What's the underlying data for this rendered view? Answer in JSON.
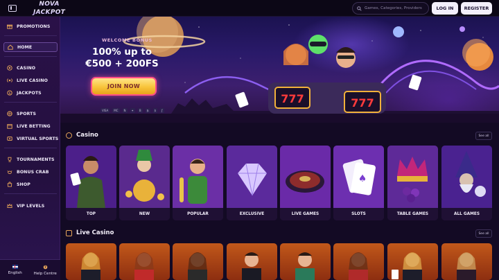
{
  "topbar": {
    "logo_line1": "NOVA",
    "logo_line2": "JACKPOT",
    "search_placeholder": "Games, Categories, Providers",
    "login_label": "LOG IN",
    "register_label": "REGISTER"
  },
  "sidebar": {
    "items": [
      {
        "label": "PROMOTIONS",
        "icon": "gift-icon"
      },
      {
        "label": "HOME",
        "icon": "home-icon",
        "active": true
      },
      {
        "label": "CASINO",
        "icon": "chip-icon"
      },
      {
        "label": "LIVE CASINO",
        "icon": "live-icon"
      },
      {
        "label": "JACKPOTS",
        "icon": "jackpot-icon"
      },
      {
        "label": "SPORTS",
        "icon": "ball-icon"
      },
      {
        "label": "LIVE BETTING",
        "icon": "calendar-icon"
      },
      {
        "label": "VIRTUAL SPORTS",
        "icon": "virtual-icon"
      },
      {
        "label": "TOURNAMENTS",
        "icon": "trophy-icon"
      },
      {
        "label": "BONUS CRAB",
        "icon": "crab-icon"
      },
      {
        "label": "SHOP",
        "icon": "shop-icon"
      },
      {
        "label": "VIP LEVELS",
        "icon": "crown-icon"
      }
    ],
    "language_label": "English",
    "help_label": "Help Centre"
  },
  "hero": {
    "kicker": "WELCOME BONUS",
    "title": "100% up to €500 + 200FS",
    "cta_label": "JOIN NOW",
    "payment_methods": [
      "VISA",
      "MC",
      "N",
      "✦",
      "B",
      "₿",
      "$",
      "ƒ"
    ]
  },
  "casino": {
    "title": "Casino",
    "see_all": "See all",
    "tiles": [
      "TOP",
      "NEW",
      "POPULAR",
      "EXCLUSIVE",
      "LIVE GAMES",
      "SLOTS",
      "TABLE GAMES",
      "ALL GAMES"
    ]
  },
  "live_casino": {
    "title": "Live Casino",
    "see_all": "See all"
  },
  "colors": {
    "accent": "#e8a65a",
    "sidebar_bg": "#2a1148",
    "page_bg": "#130a24",
    "cta_yellow": "#f8c43a",
    "cta_border": "#ff4f86"
  }
}
